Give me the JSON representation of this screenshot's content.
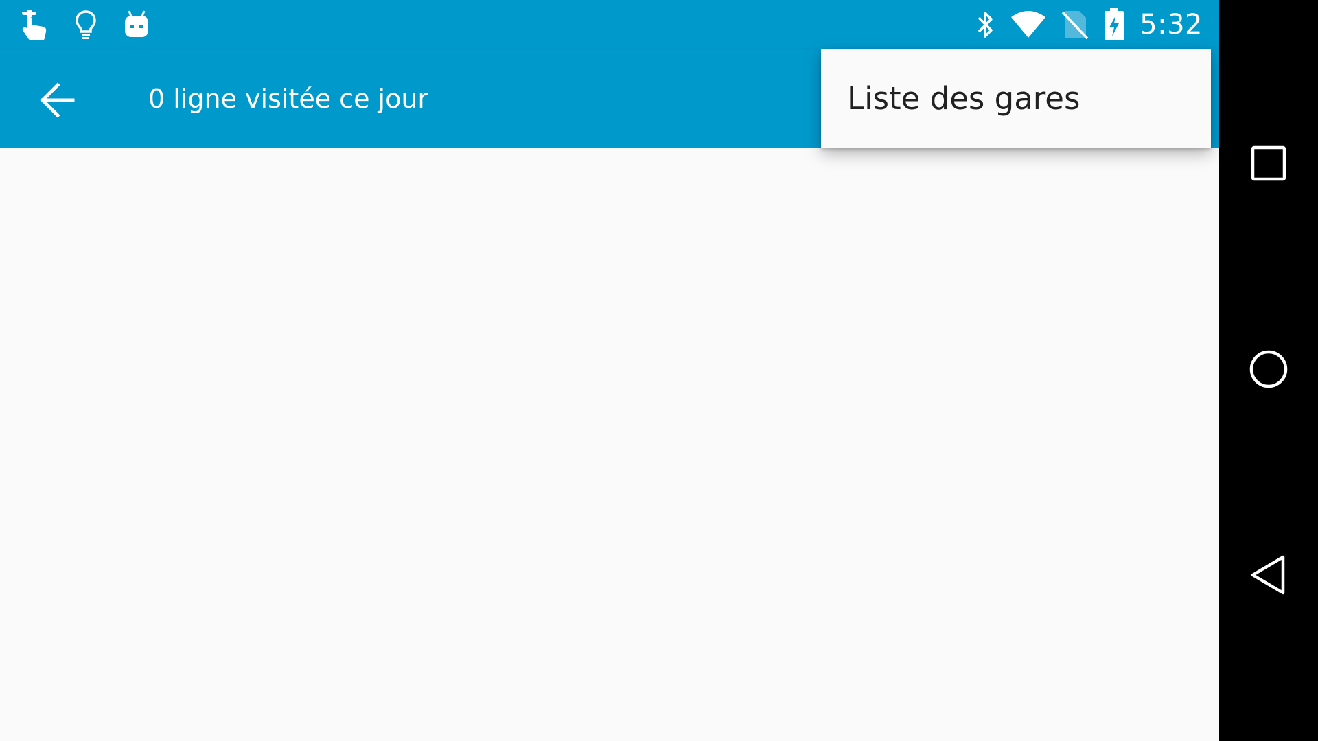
{
  "status_bar": {
    "time": "5:32",
    "left_icons": [
      "touch-gesture-icon",
      "lightbulb-icon",
      "android-bot-icon"
    ],
    "right_icons": [
      "bluetooth-icon",
      "wifi-icon",
      "no-sim-icon",
      "battery-charging-icon"
    ]
  },
  "app_bar": {
    "title": "0 ligne visitée ce jour",
    "back_icon": "arrow-back-icon"
  },
  "overflow_menu": {
    "items": [
      {
        "label": "Liste des gares"
      }
    ]
  },
  "navigation_bar": {
    "buttons": [
      "recents-icon",
      "home-icon",
      "back-triangle-icon"
    ]
  },
  "colors": {
    "primary": "#0099cc",
    "background": "#fafafa",
    "menu_text": "#212121",
    "nav_bar": "#000000"
  }
}
